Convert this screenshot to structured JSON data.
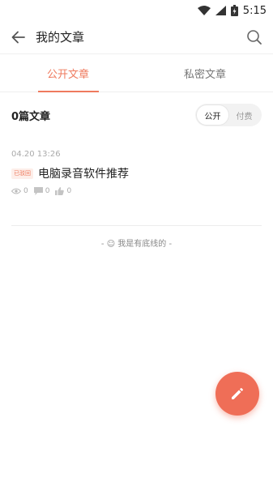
{
  "status_bar": {
    "time": "5:15",
    "icons": [
      "wifi-icon",
      "signal-icon",
      "battery-icon"
    ]
  },
  "header": {
    "title": "我的文章",
    "back_icon": "arrow-left-icon",
    "search_icon": "search-icon"
  },
  "tabs": [
    {
      "label": "公开文章",
      "active": true
    },
    {
      "label": "私密文章",
      "active": false
    }
  ],
  "summary": {
    "count_label": "0篇文章",
    "filter_options": [
      {
        "label": "公开",
        "active": true
      },
      {
        "label": "付费",
        "active": false
      }
    ]
  },
  "articles": [
    {
      "time": "04.20 13:26",
      "badge": "已驳回",
      "title": "电脑录音软件推荐",
      "views": "0",
      "comments": "0",
      "likes": "0"
    }
  ],
  "footer": {
    "note": "- ☺ 我是有底线的 -"
  },
  "fab": {
    "icon": "pencil-icon"
  },
  "colors": {
    "accent": "#ef7a5e",
    "fab": "#ef6e57",
    "muted": "#aaaaaa"
  }
}
